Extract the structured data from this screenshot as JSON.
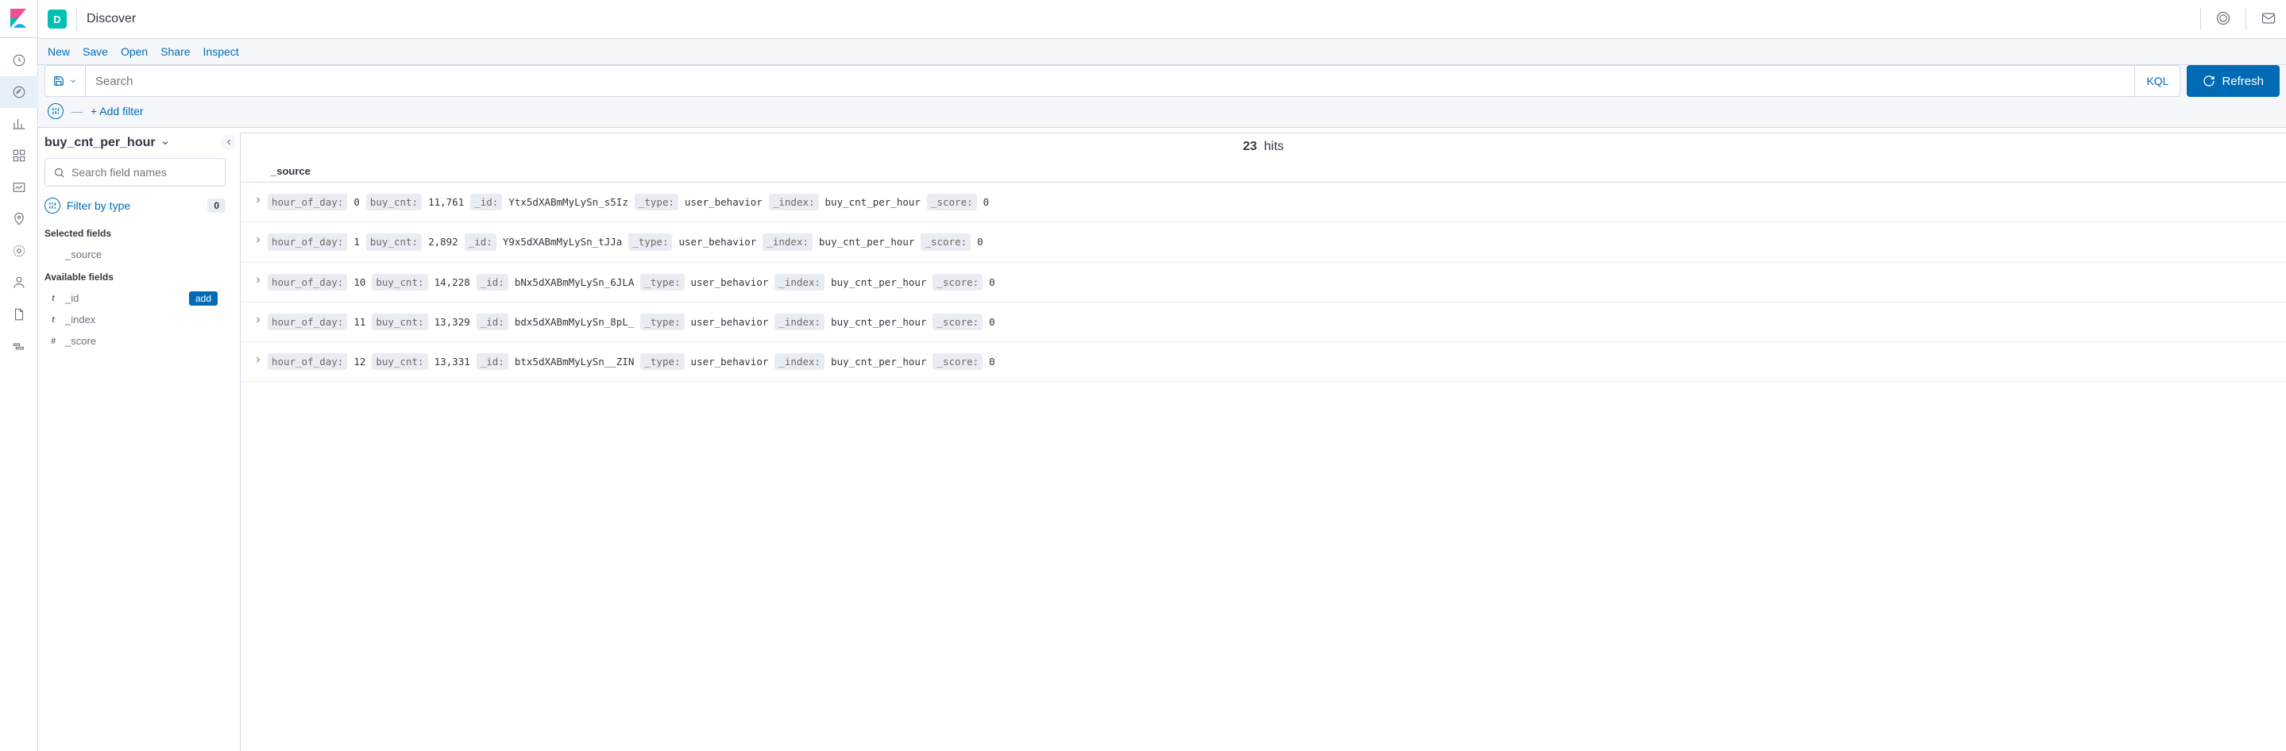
{
  "header": {
    "app_letter": "D",
    "title": "Discover"
  },
  "action_bar": {
    "new": "New",
    "save": "Save",
    "open": "Open",
    "share": "Share",
    "inspect": "Inspect"
  },
  "search": {
    "placeholder": "Search",
    "kql": "KQL",
    "refresh": "Refresh"
  },
  "filter_bar": {
    "add_filter": "+ Add filter"
  },
  "sidebar": {
    "index_pattern": "buy_cnt_per_hour",
    "field_search_placeholder": "Search field names",
    "filter_by_type": "Filter by type",
    "filter_count": "0",
    "selected_fields_title": "Selected fields",
    "selected_fields": [
      {
        "type": "code",
        "icon": "</>",
        "name": "_source"
      }
    ],
    "available_fields_title": "Available fields",
    "available_fields": [
      {
        "type": "t",
        "icon": "t",
        "name": "_id",
        "hovered": true
      },
      {
        "type": "t",
        "icon": "t",
        "name": "_index"
      },
      {
        "type": "num",
        "icon": "#",
        "name": "_score"
      }
    ],
    "add_label": "add"
  },
  "results": {
    "hits_count": "23",
    "hits_label": "hits",
    "column_header": "_source",
    "rows": [
      {
        "hour_of_day": "0",
        "buy_cnt": "11,761",
        "_id": "Ytx5dXABmMyLySn_s5Iz",
        "_type": "user_behavior",
        "_index": "buy_cnt_per_hour",
        "_score": "0"
      },
      {
        "hour_of_day": "1",
        "buy_cnt": "2,892",
        "_id": "Y9x5dXABmMyLySn_tJJa",
        "_type": "user_behavior",
        "_index": "buy_cnt_per_hour",
        "_score": "0"
      },
      {
        "hour_of_day": "10",
        "buy_cnt": "14,228",
        "_id": "bNx5dXABmMyLySn_6JLA",
        "_type": "user_behavior",
        "_index": "buy_cnt_per_hour",
        "_score": "0"
      },
      {
        "hour_of_day": "11",
        "buy_cnt": "13,329",
        "_id": "bdx5dXABmMyLySn_8pL_",
        "_type": "user_behavior",
        "_index": "buy_cnt_per_hour",
        "_score": "0"
      },
      {
        "hour_of_day": "12",
        "buy_cnt": "13,331",
        "_id": "btx5dXABmMyLySn__ZIN",
        "_type": "user_behavior",
        "_index": "buy_cnt_per_hour",
        "_score": "0"
      }
    ]
  }
}
